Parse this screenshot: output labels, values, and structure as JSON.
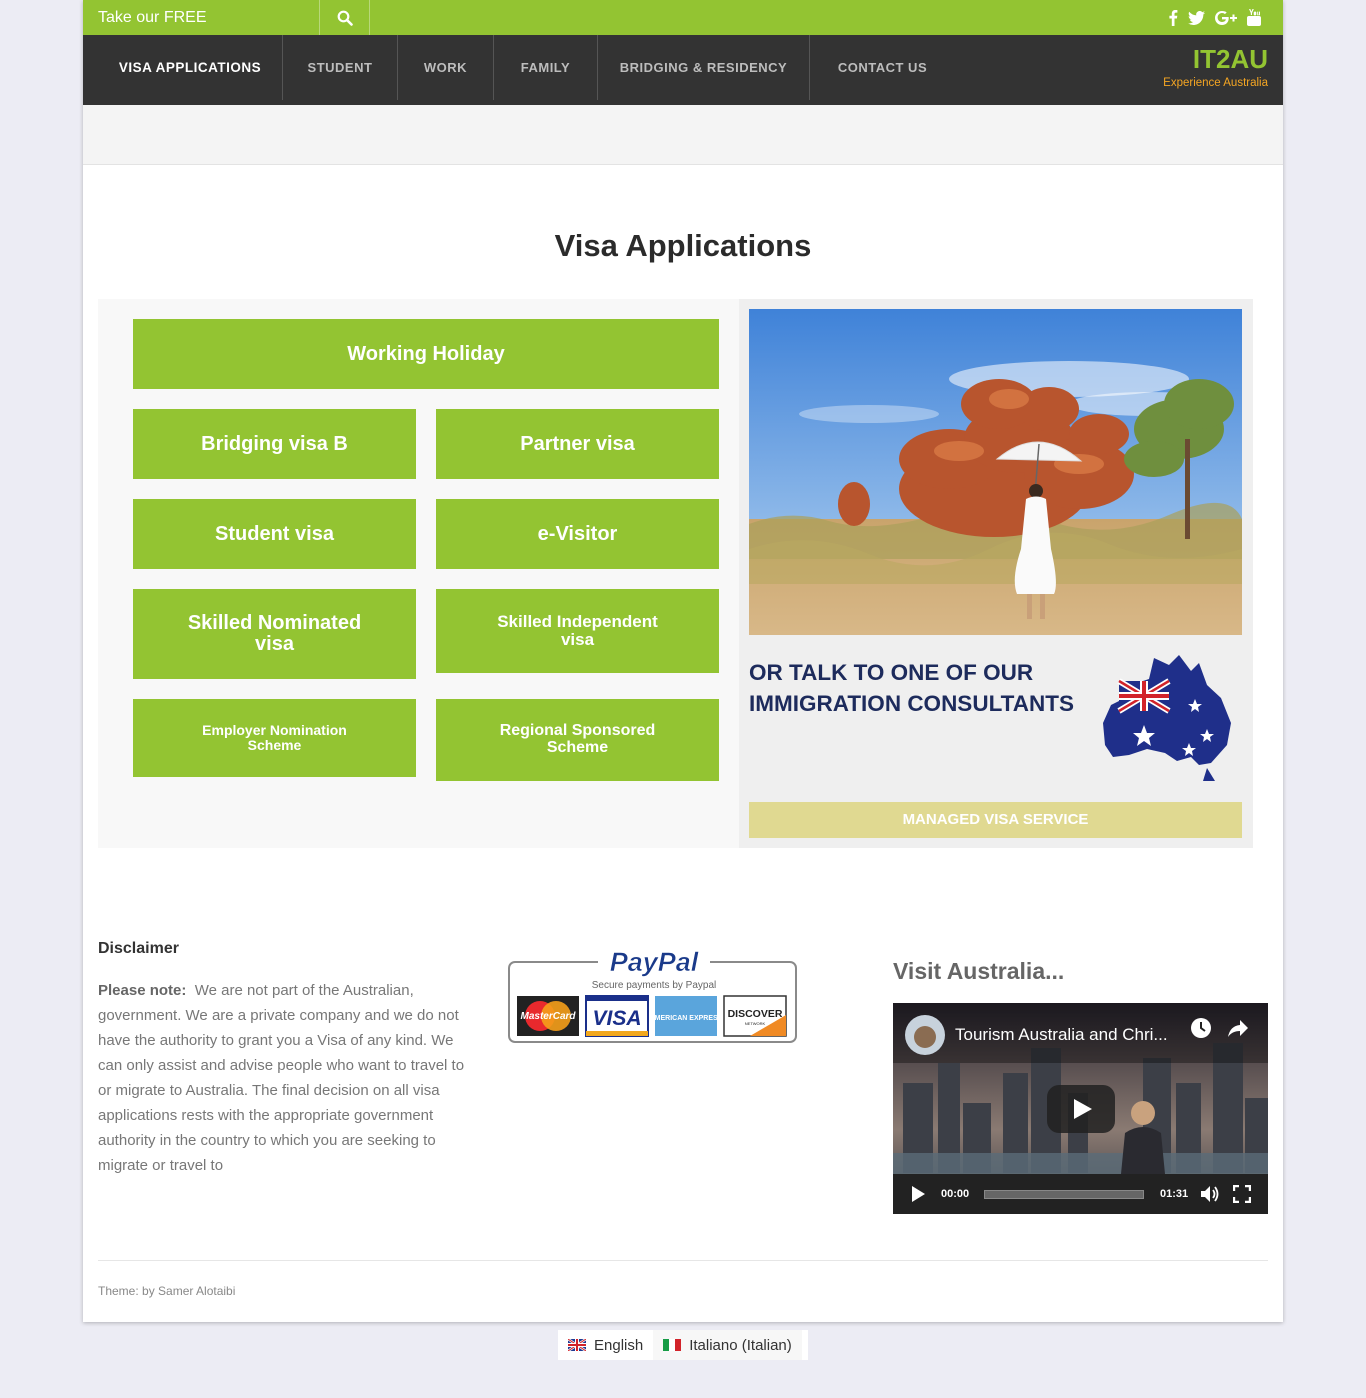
{
  "topbar": {
    "assessment_label": "Take our FREE ASSESSMENT",
    "search_icon": "search-icon",
    "social_icons": [
      "facebook-icon",
      "twitter-icon",
      "google-plus-icon",
      "youtube-icon"
    ]
  },
  "nav": {
    "items": [
      "VISA APPLICATIONS",
      "STUDENT",
      "WORK",
      "FAMILY",
      "BRIDGING & RESIDENCY",
      "CONTACT US"
    ],
    "active_index": 0
  },
  "brand": {
    "name": "IT2AU",
    "tagline": "Experience Australia"
  },
  "page": {
    "title": "Visa Applications"
  },
  "visa_buttons": {
    "working_holiday": "Working Holiday",
    "bridging_b": "Bridging visa B",
    "partner": "Partner visa",
    "student": "Student visa",
    "evisitor": "e-Visitor",
    "skilled_nominated": "Skilled Nominated visa",
    "skilled_independent": "Skilled Independent visa",
    "employer_nomination": "Employer Nomination Scheme",
    "regional_sponsored": "Regional Sponsored Scheme"
  },
  "promo": {
    "talk_text": "OR TALK TO ONE OF OUR IMMIGRATION CONSULTANTS",
    "managed_label": "MANAGED VISA SERVICE"
  },
  "disclaimer": {
    "title": "Disclaimer",
    "lead": "Please note:",
    "body": "We are not part of the Australian, government. We are a private company and we do not have the authority to grant you a Visa of any kind. We can only assist and advise people who want to travel to or migrate to Australia. The final decision on all visa applications rests with the appropriate government authority in the country to which you are seeking to migrate or travel to"
  },
  "payments": {
    "brand": "PayPal",
    "caption": "Secure payments by Paypal",
    "cards": [
      "MasterCard",
      "VISA",
      "AMERICAN EXPRESS",
      "DISCOVER"
    ],
    "discover_sub": "NETWORK"
  },
  "video": {
    "heading": "Visit Australia...",
    "title": "Tourism Australia and Chri...",
    "current_time": "00:00",
    "duration": "01:31"
  },
  "footer": {
    "credit": "Theme: by Samer Alotaibi"
  },
  "languages": [
    {
      "label": "English"
    },
    {
      "label": "Italiano (Italian)"
    }
  ],
  "colors": {
    "accent_green": "#93c432",
    "nav_dark": "#333333",
    "brand_orange": "#f5a623",
    "consultant_navy": "#1d2b5c",
    "managed_khaki": "#e0d991"
  }
}
